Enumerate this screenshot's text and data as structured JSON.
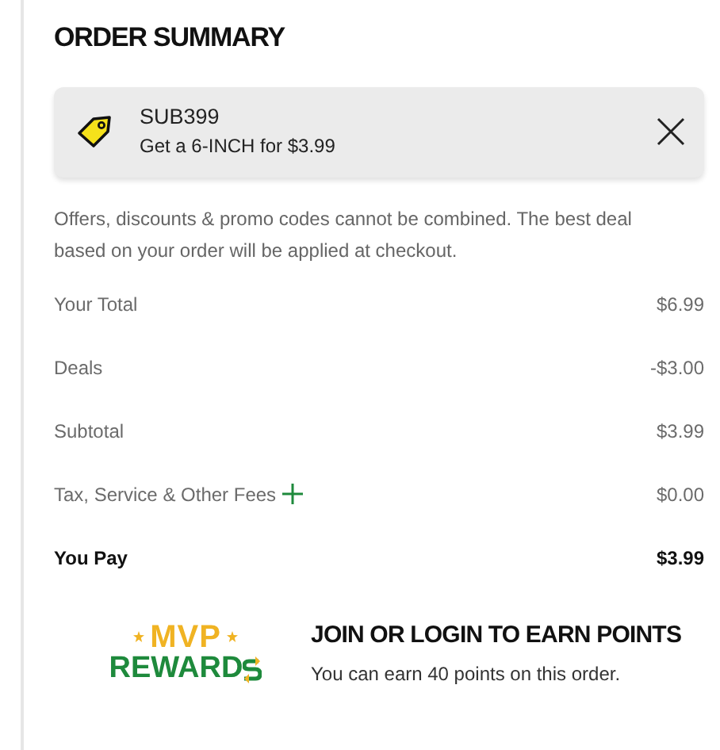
{
  "title": "ORDER SUMMARY",
  "promo": {
    "code": "SUB399",
    "description": "Get a 6-INCH for $3.99"
  },
  "note": "Offers, discounts & promo codes cannot be combined. The best deal based on your order will be applied at checkout.",
  "rows": [
    {
      "kind": "plain",
      "label": "Your Total",
      "value": "$6.99"
    },
    {
      "kind": "plain",
      "label": "Deals",
      "value": "-$3.00"
    },
    {
      "kind": "plain",
      "label": "Subtotal",
      "value": "$3.99"
    },
    {
      "kind": "expandable",
      "label": "Tax, Service & Other Fees",
      "value": "$0.00"
    },
    {
      "kind": "total",
      "label": "You Pay",
      "value": "$3.99"
    }
  ],
  "rewards": {
    "logo_top": "MVP",
    "logo_bottom": "REWARD",
    "heading": "JOIN OR LOGIN TO EARN POINTS",
    "text": "You can earn 40 points on this order."
  }
}
